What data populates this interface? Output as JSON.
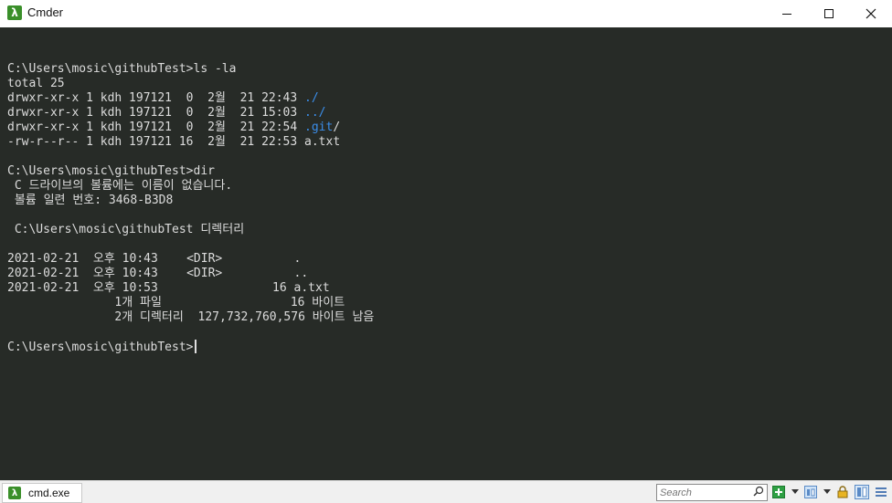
{
  "window": {
    "title": "Cmder",
    "app_icon": "λ",
    "controls": [
      "minimize",
      "maximize",
      "close"
    ]
  },
  "terminal": {
    "lines": [
      {
        "text": ""
      },
      {
        "text": "C:\\Users\\mosic\\githubTest>ls -la"
      },
      {
        "text": "total 25"
      },
      {
        "text": "drwxr-xr-x 1 kdh 197121  0  2월  21 22:43 ",
        "link": "./"
      },
      {
        "text": "drwxr-xr-x 1 kdh 197121  0  2월  21 15:03 ",
        "link": "../"
      },
      {
        "text": "drwxr-xr-x 1 kdh 197121  0  2월  21 22:54 ",
        "link": ".git",
        "suffix": "/"
      },
      {
        "text": "-rw-r--r-- 1 kdh 197121 16  2월  21 22:53 a.txt"
      },
      {
        "text": ""
      },
      {
        "text": "C:\\Users\\mosic\\githubTest>dir"
      },
      {
        "text": " C 드라이브의 볼륨에는 이름이 없습니다."
      },
      {
        "text": " 볼륨 일련 번호: 3468-B3D8"
      },
      {
        "text": ""
      },
      {
        "text": " C:\\Users\\mosic\\githubTest 디렉터리"
      },
      {
        "text": ""
      },
      {
        "text": "2021-02-21  오후 10:43    <DIR>          ."
      },
      {
        "text": "2021-02-21  오후 10:43    <DIR>          .."
      },
      {
        "text": "2021-02-21  오후 10:53                16 a.txt"
      },
      {
        "text": "               1개 파일                  16 바이트"
      },
      {
        "text": "               2개 디렉터리  127,732,760,576 바이트 남음"
      },
      {
        "text": ""
      },
      {
        "text": "C:\\Users\\mosic\\githubTest>",
        "cursor": true
      }
    ]
  },
  "statusbar": {
    "tab_label": "cmd.exe",
    "search_placeholder": "Search",
    "icons": [
      "new-console-icon",
      "dropdown-icon",
      "split-view-icon",
      "dropdown-icon",
      "lock-icon",
      "active-pane-icon",
      "menu-icon"
    ]
  },
  "colors": {
    "terminal_bg": "#272b27",
    "terminal_fg": "#dcdcdc",
    "link_blue": "#3b8eea",
    "cmder_green": "#3a8f2a"
  }
}
